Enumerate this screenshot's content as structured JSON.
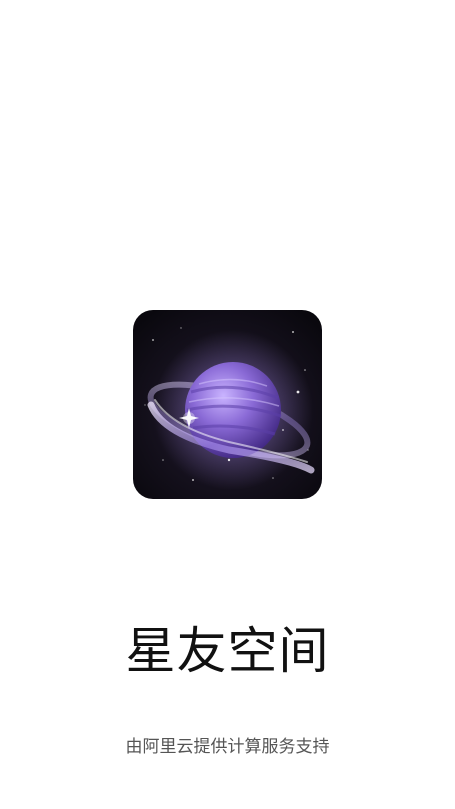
{
  "splash": {
    "app_name": "星友空间",
    "footer": "由阿里云提供计算服务支持",
    "icon": "purple-planet-icon"
  },
  "colors": {
    "background": "#ffffff",
    "title": "#111111",
    "footer": "#555555",
    "planet": "#8a6ad6"
  }
}
